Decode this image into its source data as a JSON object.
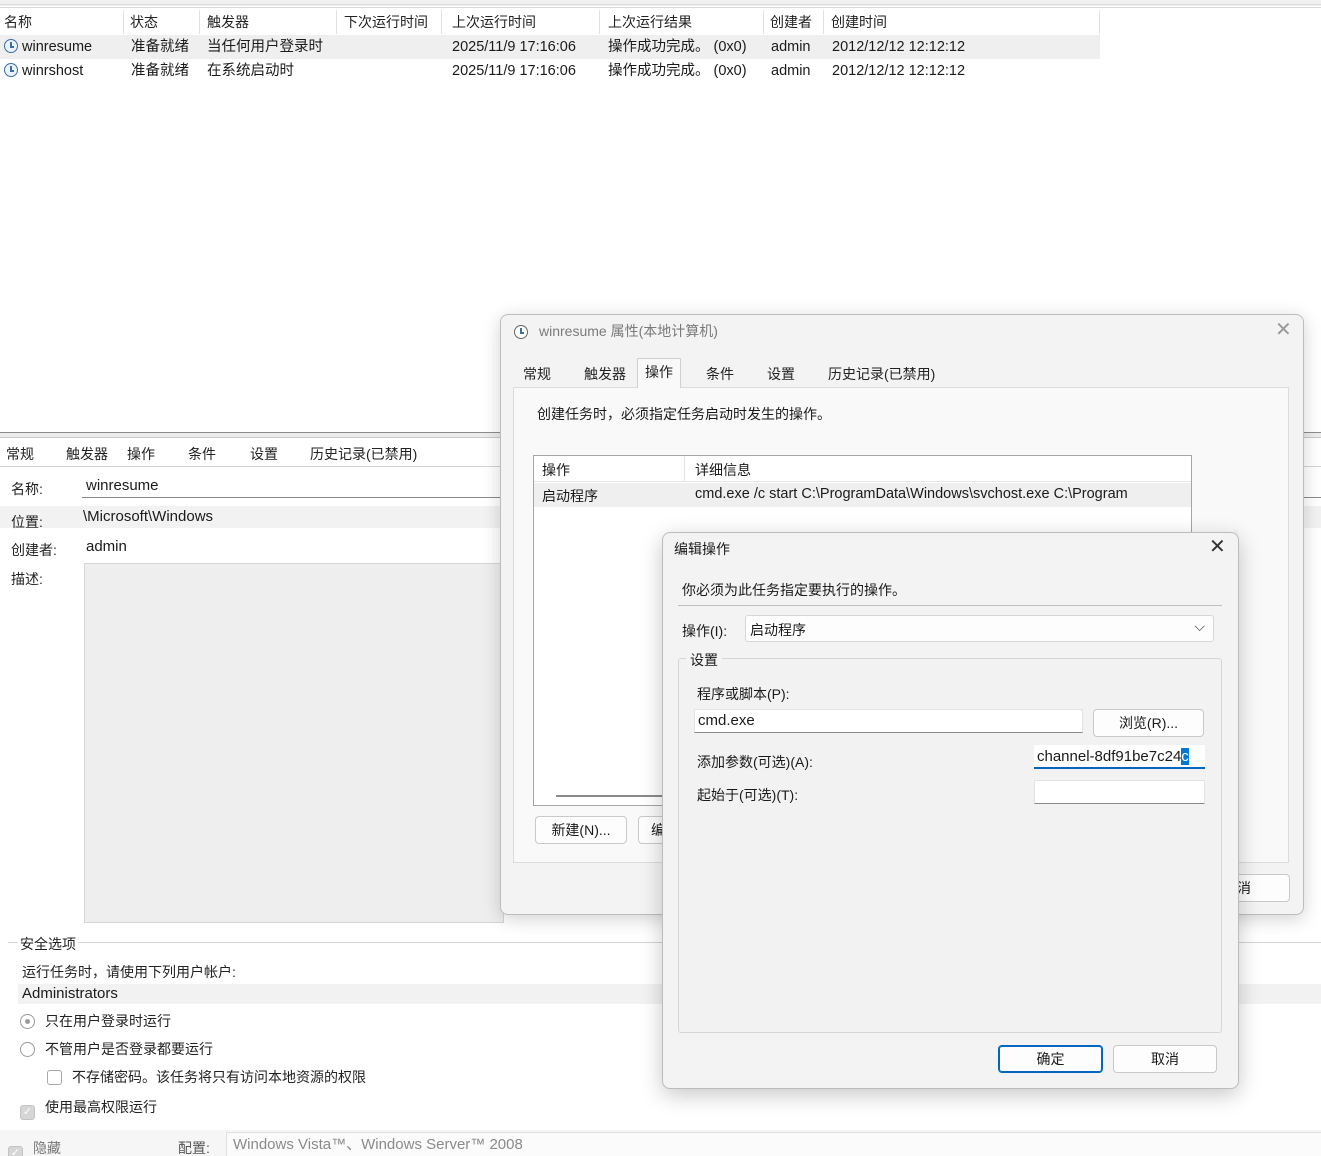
{
  "task_list": {
    "columns": [
      "名称",
      "状态",
      "触发器",
      "下次运行时间",
      "上次运行时间",
      "上次运行结果",
      "创建者",
      "创建时间"
    ],
    "rows": [
      {
        "name": "winresume",
        "status": "准备就绪",
        "trigger": "当任何用户登录时",
        "next_run": "",
        "last_run": "2025/11/9 17:16:06",
        "last_result": "操作成功完成。 (0x0)",
        "author": "admin",
        "created": "2012/12/12 12:12:12"
      },
      {
        "name": "winrshost",
        "status": "准备就绪",
        "trigger": "在系统启动时",
        "next_run": "",
        "last_run": "2025/11/9 17:16:06",
        "last_result": "操作成功完成。 (0x0)",
        "author": "admin",
        "created": "2012/12/12 12:12:12"
      }
    ]
  },
  "bottom_pane": {
    "tabs": [
      "常规",
      "触发器",
      "操作",
      "条件",
      "设置",
      "历史记录(已禁用)"
    ],
    "name_label": "名称:",
    "name_value": "winresume",
    "location_label": "位置:",
    "location_value": "\\Microsoft\\Windows",
    "author_label": "创建者:",
    "author_value": "admin",
    "desc_label": "描述:",
    "security_title": "安全选项",
    "run_as_label": "运行任务时，请使用下列用户帐户:",
    "run_as_value": "Administrators",
    "radio_logged_on": "只在用户登录时运行",
    "radio_whether": "不管用户是否登录都要运行",
    "check_no_store": "不存储密码。该任务将只有访问本地资源的权限",
    "check_highest": "使用最高权限运行",
    "check_hidden": "隐藏",
    "config_label": "配置:",
    "config_value": "Windows Vista™、Windows Server™ 2008"
  },
  "prop_dialog": {
    "title": "winresume 属性(本地计算机)",
    "tabs": [
      "常规",
      "触发器",
      "操作",
      "条件",
      "设置",
      "历史记录(已禁用)"
    ],
    "active_tab": "操作",
    "instruction": "创建任务时，必须指定任务启动时发生的操作。",
    "list_headers": [
      "操作",
      "详细信息"
    ],
    "list_rows": [
      {
        "action": "启动程序",
        "detail": "cmd.exe /c start C:\\ProgramData\\Windows\\svchost.exe C:\\Program"
      }
    ],
    "new_button": "新建(N)...",
    "edit_button_partial": "编",
    "cancel_partial": "消"
  },
  "edit_dialog": {
    "title": "编辑操作",
    "instruction": "你必须为此任务指定要执行的操作。",
    "action_label": "操作(I):",
    "action_value": "启动程序",
    "settings_label": "设置",
    "program_label": "程序或脚本(P):",
    "program_value": "cmd.exe",
    "browse_button": "浏览(R)...",
    "args_label": "添加参数(可选)(A):",
    "args_value": "channel-8df91be7c24",
    "args_selected": "c",
    "start_in_label": "起始于(可选)(T):",
    "start_in_value": "",
    "ok_button": "确定",
    "cancel_button": "取消"
  },
  "colors": {
    "accent": "#0067c0",
    "selection": "#0078d4",
    "dialog_bg": "#f3f3f3"
  }
}
